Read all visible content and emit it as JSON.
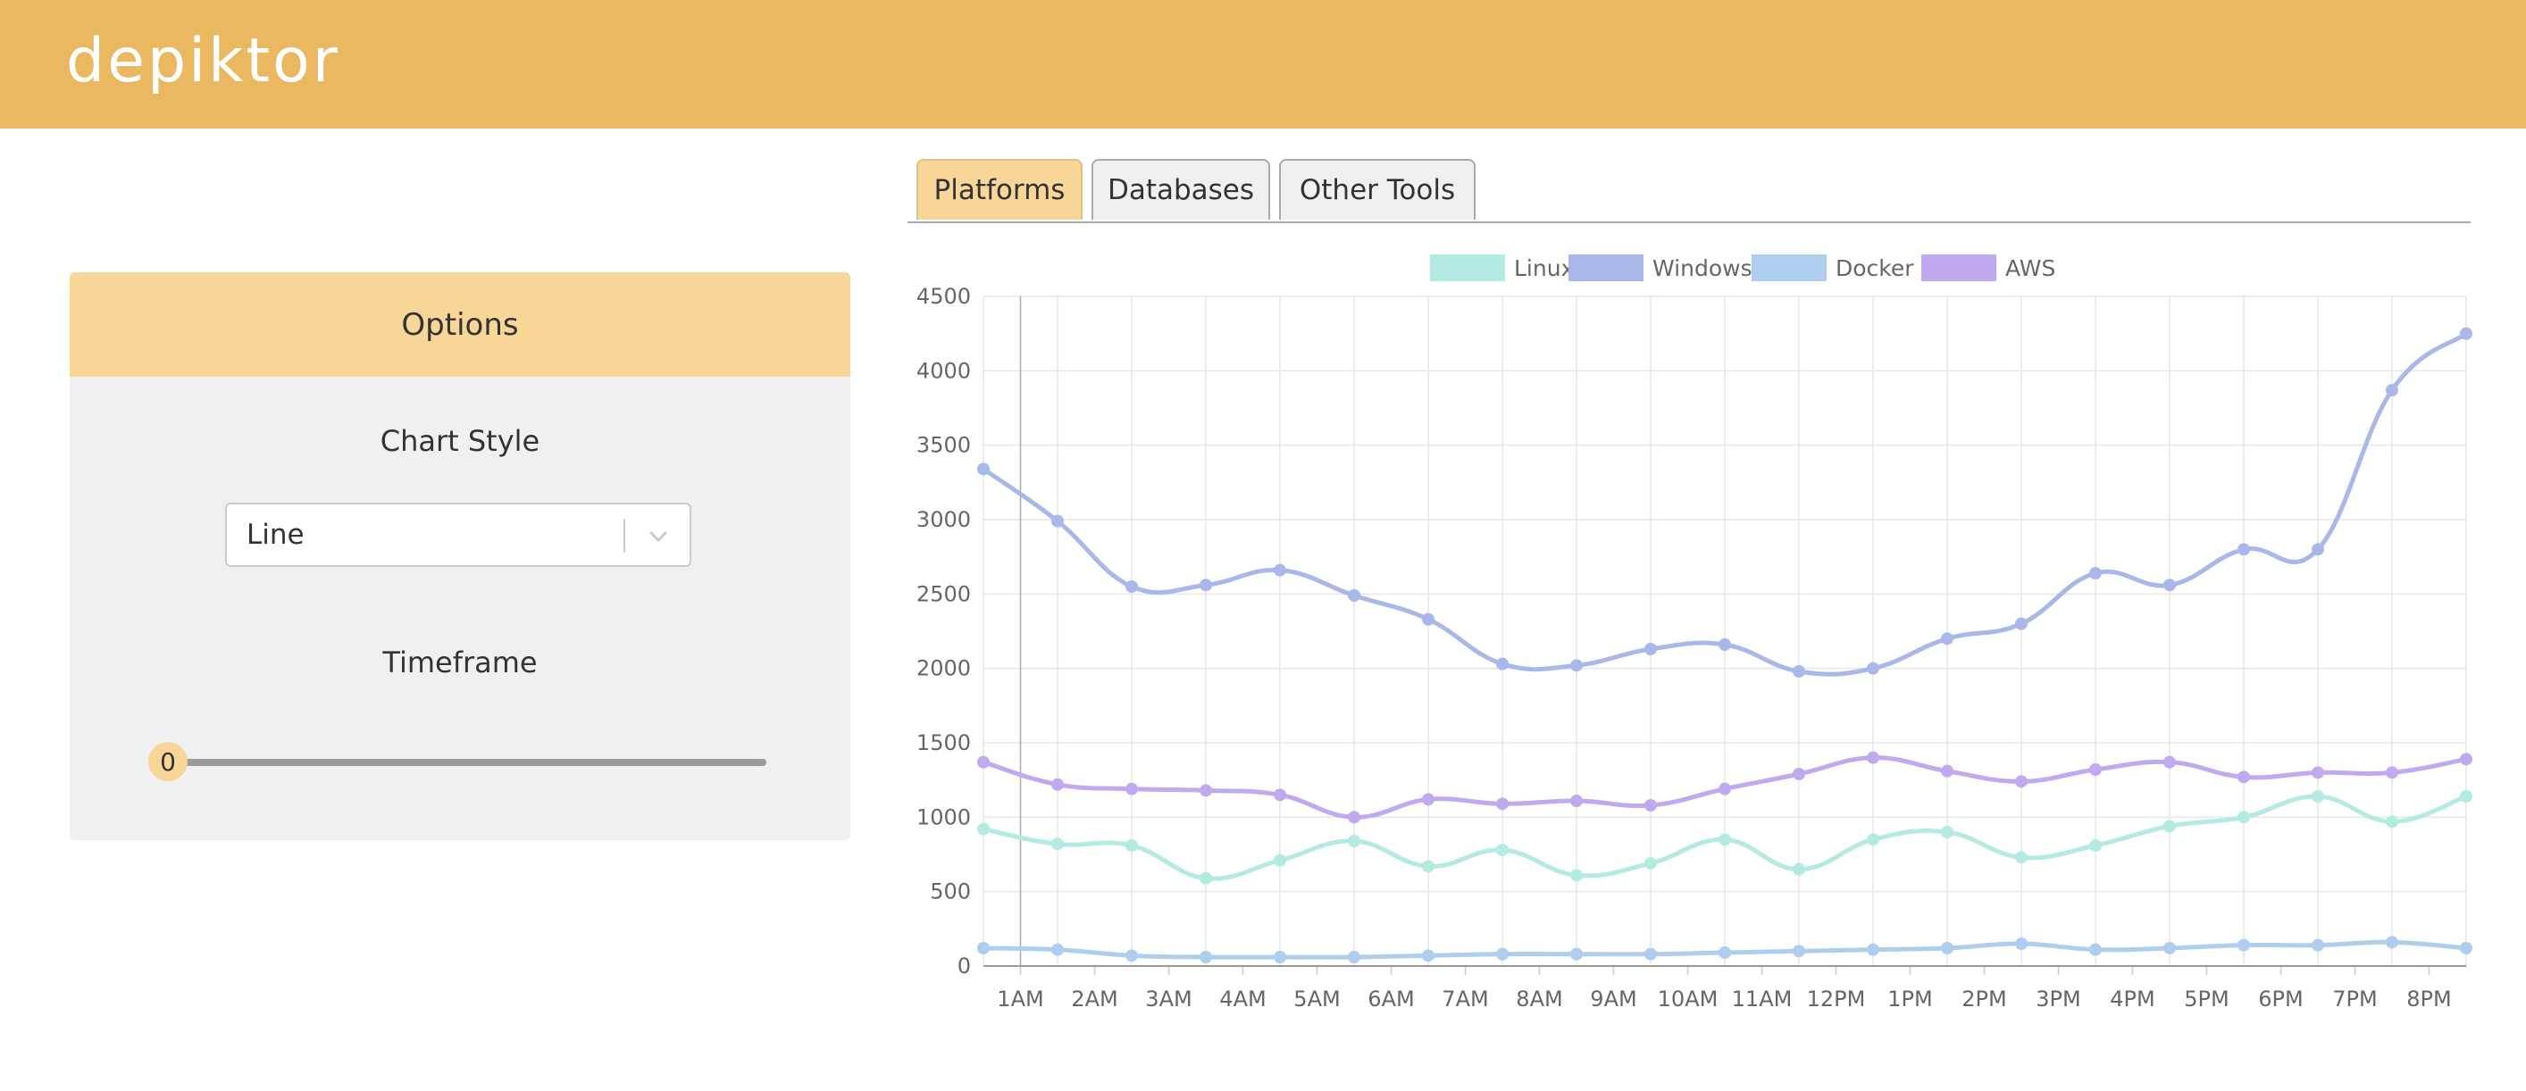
{
  "app": {
    "brand": "depiktor"
  },
  "options": {
    "title": "Options",
    "chart_style_label": "Chart Style",
    "chart_style_value": "Line",
    "timeframe_label": "Timeframe",
    "timeframe_value": "0"
  },
  "tabs": [
    {
      "label": "Platforms",
      "active": true
    },
    {
      "label": "Databases",
      "active": false
    },
    {
      "label": "Other Tools",
      "active": false
    }
  ],
  "chart_data": {
    "type": "line",
    "categories": [
      "1AM",
      "2AM",
      "3AM",
      "4AM",
      "5AM",
      "6AM",
      "7AM",
      "8AM",
      "9AM",
      "10AM",
      "11AM",
      "12PM",
      "1PM",
      "2PM",
      "3PM",
      "4PM",
      "5PM",
      "6PM",
      "7PM",
      "8PM"
    ],
    "ylim": [
      0,
      4500
    ],
    "yticks": [
      0,
      500,
      1000,
      1500,
      2000,
      2500,
      3000,
      3500,
      4000,
      4500
    ],
    "grid": true,
    "legend_position": "top",
    "series": [
      {
        "name": "Linux",
        "color": "#b3ebe3",
        "values": [
          920,
          820,
          810,
          590,
          710,
          840,
          670,
          780,
          610,
          690,
          850,
          650,
          850,
          900,
          730,
          810,
          940,
          1000,
          1140,
          970,
          1140
        ]
      },
      {
        "name": "Windows",
        "color": "#a9b8e8",
        "values": [
          3340,
          2990,
          2550,
          2560,
          2660,
          2490,
          2330,
          2030,
          2020,
          2130,
          2160,
          1980,
          2000,
          2200,
          2300,
          2640,
          2560,
          2800,
          2800,
          3870,
          4250
        ]
      },
      {
        "name": "Docker",
        "color": "#afcdee",
        "values": [
          120,
          110,
          70,
          60,
          60,
          60,
          70,
          80,
          80,
          80,
          90,
          100,
          110,
          120,
          150,
          110,
          120,
          140,
          140,
          160,
          120
        ]
      },
      {
        "name": "AWS",
        "color": "#c0a9ee",
        "values": [
          1370,
          1220,
          1190,
          1180,
          1150,
          1000,
          1120,
          1090,
          1110,
          1080,
          1190,
          1290,
          1400,
          1310,
          1240,
          1320,
          1370,
          1270,
          1300,
          1300,
          1390
        ]
      }
    ]
  }
}
